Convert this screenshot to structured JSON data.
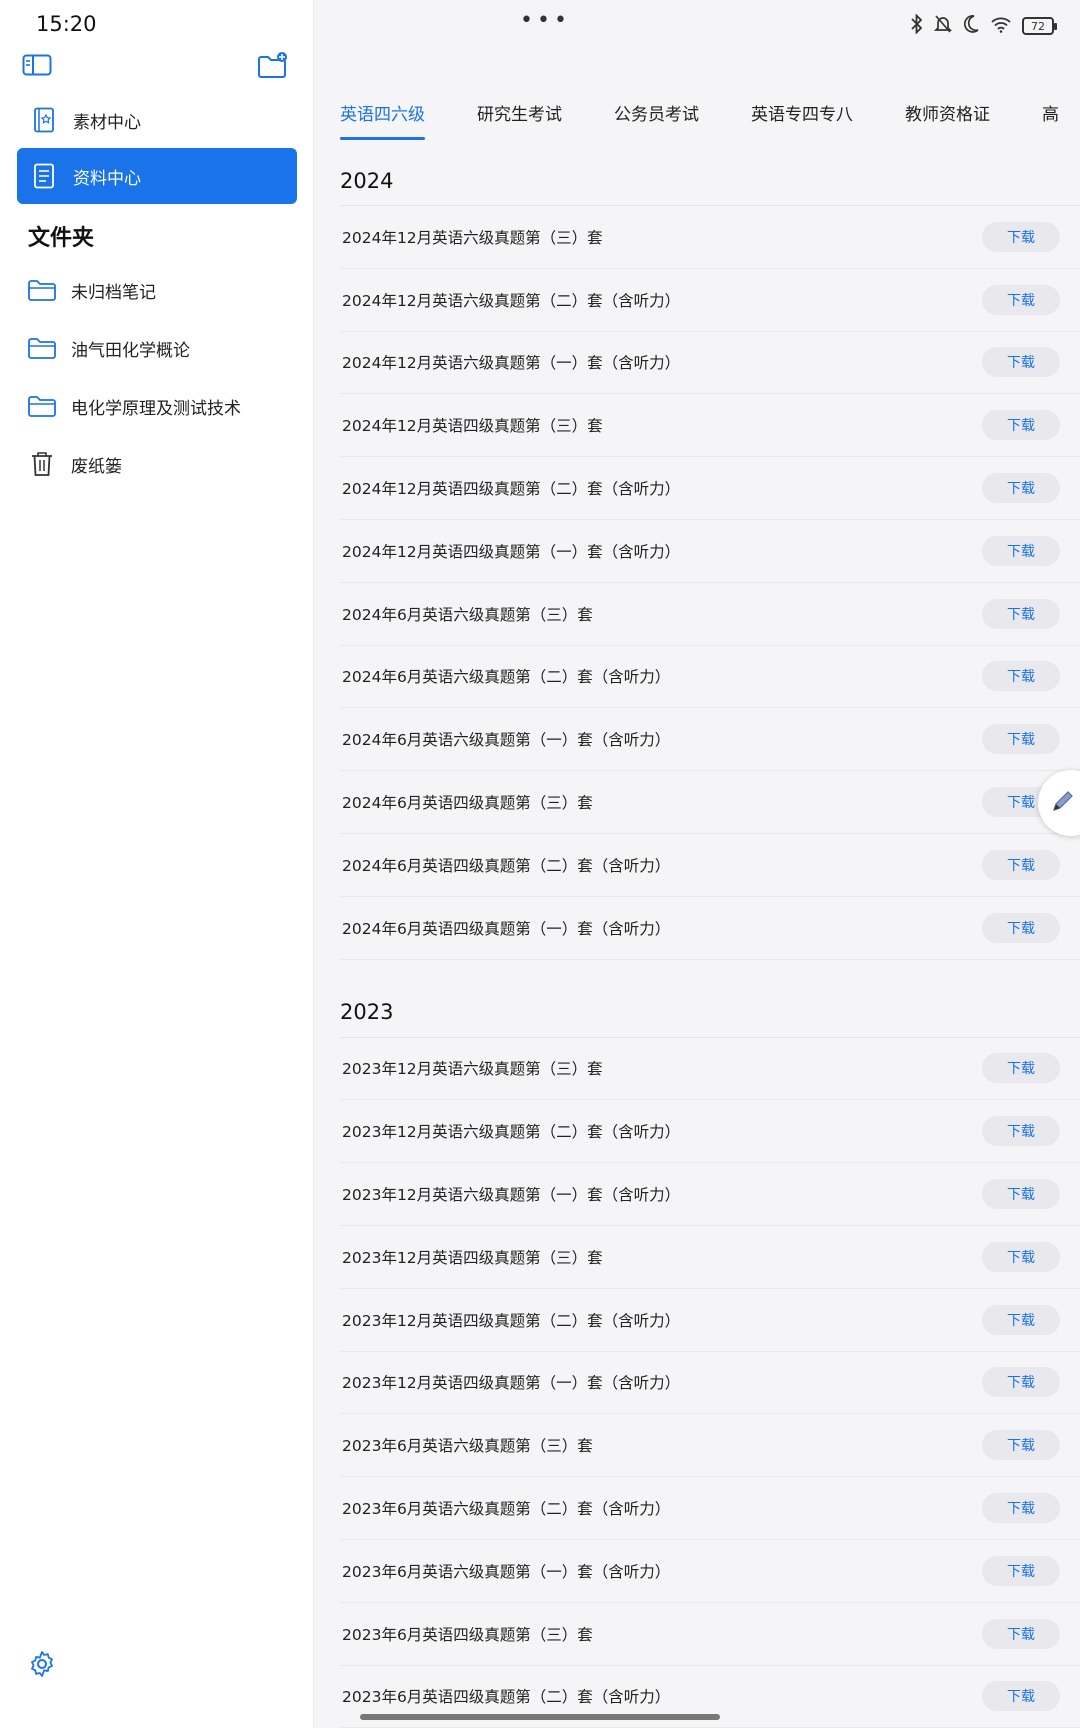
{
  "status_bar": {
    "time": "15:20",
    "battery": "72"
  },
  "sidebar": {
    "nav": [
      {
        "label": "素材中心",
        "icon": "material-center-icon",
        "active": false
      },
      {
        "label": "资料中心",
        "icon": "document-center-icon",
        "active": true
      }
    ],
    "folders_title": "文件夹",
    "folders": [
      {
        "label": "未归档笔记",
        "icon": "folder-icon"
      },
      {
        "label": "油气田化学概论",
        "icon": "folder-icon"
      },
      {
        "label": "电化学原理及测试技术",
        "icon": "folder-icon"
      },
      {
        "label": "废纸篓",
        "icon": "trash-icon"
      }
    ]
  },
  "tabs": [
    {
      "label": "英语四六级",
      "active": true
    },
    {
      "label": "研究生考试",
      "active": false
    },
    {
      "label": "公务员考试",
      "active": false
    },
    {
      "label": "英语专四专八",
      "active": false
    },
    {
      "label": "教师资格证",
      "active": false
    },
    {
      "label": "高",
      "active": false
    }
  ],
  "download_label": "下载",
  "sections": [
    {
      "year": "2024",
      "items": [
        "2024年12月英语六级真题第（三）套",
        "2024年12月英语六级真题第（二）套（含听力）",
        "2024年12月英语六级真题第（一）套（含听力）",
        "2024年12月英语四级真题第（三）套",
        "2024年12月英语四级真题第（二）套（含听力）",
        "2024年12月英语四级真题第（一）套（含听力）",
        "2024年6月英语六级真题第（三）套",
        "2024年6月英语六级真题第（二）套（含听力）",
        "2024年6月英语六级真题第（一）套（含听力）",
        "2024年6月英语四级真题第（三）套",
        "2024年6月英语四级真题第（二）套（含听力）",
        "2024年6月英语四级真题第（一）套（含听力）"
      ]
    },
    {
      "year": "2023",
      "items": [
        "2023年12月英语六级真题第（三）套",
        "2023年12月英语六级真题第（二）套（含听力）",
        "2023年12月英语六级真题第（一）套（含听力）",
        "2023年12月英语四级真题第（三）套",
        "2023年12月英语四级真题第（二）套（含听力）",
        "2023年12月英语四级真题第（一）套（含听力）",
        "2023年6月英语六级真题第（三）套",
        "2023年6月英语六级真题第（二）套（含听力）",
        "2023年6月英语六级真题第（一）套（含听力）",
        "2023年6月英语四级真题第（三）套",
        "2023年6月英语四级真题第（二）套（含听力）"
      ]
    }
  ],
  "colors": {
    "accent": "#1a73e8",
    "sidebar_bg": "#ffffff",
    "main_bg": "#f5f5f7",
    "button_bg": "#e8e8ed"
  }
}
